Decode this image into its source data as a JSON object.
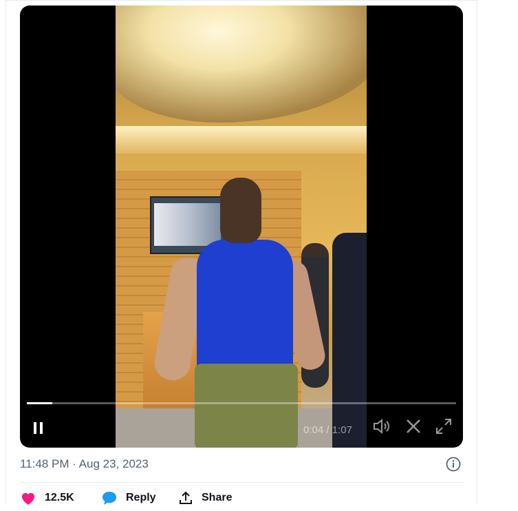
{
  "tweet": {
    "timestamp": "11:48 PM · Aug 23, 2023"
  },
  "video": {
    "current_time": "0:04",
    "duration": "1:07",
    "progress": 0.06,
    "colors": {
      "background": "#000000",
      "shirt": "#1e3fcf"
    }
  },
  "actions": {
    "like_count": "12.5K",
    "reply_label": "Reply",
    "share_label": "Share"
  },
  "colors": {
    "like": "#f91880",
    "reply": "#1d9bf0",
    "text": "#0f1419",
    "meta": "#536471"
  },
  "icons": [
    "pause-icon",
    "volume-icon",
    "x-logo-icon",
    "fullscreen-icon",
    "info-icon",
    "heart-icon",
    "reply-bubble-icon",
    "share-icon"
  ]
}
